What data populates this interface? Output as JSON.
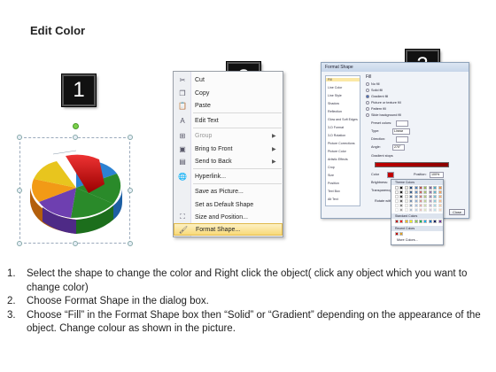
{
  "title": "Edit Color",
  "steps": {
    "badge1": "1",
    "badge2": "2",
    "badge3": "3"
  },
  "colors": {
    "pie_slices": [
      "#d11f1f",
      "#2a8a2a",
      "#6e3fb0",
      "#f29a16",
      "#e8c51e",
      "#2c82d2"
    ],
    "badge_bg": "#111111",
    "highlight": "#f8d978"
  },
  "context_menu": {
    "items": [
      {
        "label": "Cut",
        "icon": "scissors-icon",
        "disabled": false,
        "submenu": false
      },
      {
        "label": "Copy",
        "icon": "copy-icon",
        "disabled": false,
        "submenu": false
      },
      {
        "label": "Paste",
        "icon": "paste-icon",
        "disabled": false,
        "submenu": false
      },
      {
        "label": "Edit Text",
        "icon": "edit-text-icon",
        "disabled": false,
        "submenu": false
      },
      {
        "label": "Group",
        "icon": "group-icon",
        "disabled": true,
        "submenu": true
      },
      {
        "label": "Bring to Front",
        "icon": "bring-front-icon",
        "disabled": false,
        "submenu": true
      },
      {
        "label": "Send to Back",
        "icon": "send-back-icon",
        "disabled": false,
        "submenu": true
      },
      {
        "label": "Hyperlink...",
        "icon": "hyperlink-icon",
        "disabled": false,
        "submenu": false
      },
      {
        "label": "Save as Picture...",
        "icon": "",
        "disabled": false,
        "submenu": false
      },
      {
        "label": "Set as Default Shape",
        "icon": "",
        "disabled": false,
        "submenu": false
      },
      {
        "label": "Size and Position...",
        "icon": "size-icon",
        "disabled": false,
        "submenu": false
      },
      {
        "label": "Format Shape...",
        "icon": "format-shape-icon",
        "disabled": false,
        "submenu": false,
        "highlighted": true
      }
    ]
  },
  "format_dialog": {
    "title": "Format Shape",
    "nav": [
      "Fill",
      "Line Color",
      "Line Style",
      "Shadow",
      "Reflection",
      "Glow and Soft Edges",
      "3-D Format",
      "3-D Rotation",
      "Picture Corrections",
      "Picture Color",
      "Artistic Effects",
      "Crop",
      "Size",
      "Position",
      "Text Box",
      "Alt Text"
    ],
    "section_title": "Fill",
    "options": [
      "No fill",
      "Solid fill",
      "Gradient fill",
      "Picture or texture fill",
      "Pattern fill",
      "Slide background fill"
    ],
    "selected_option": "Gradient fill",
    "labels": {
      "preset": "Preset colors:",
      "type": "Type:",
      "type_value": "Linear",
      "direction": "Direction:",
      "angle": "Angle:",
      "angle_value": "270°",
      "stops": "Gradient stops",
      "color": "Color",
      "position": "Position:",
      "position_value": "100%",
      "brightness": "Brightness:",
      "transparency": "Transparency:",
      "rotate": "Rotate with shape",
      "close": "Close"
    },
    "palette": {
      "theme_label": "Theme Colors",
      "standard_label": "Standard Colors",
      "recent_label": "Recent Colors",
      "more_label": "More Colors...",
      "theme_row": [
        "#ffffff",
        "#000000",
        "#eeece1",
        "#1f497d",
        "#4f81bd",
        "#c0504d",
        "#9bbb59",
        "#8064a2",
        "#4bacc6",
        "#f79646"
      ],
      "standard_row": [
        "#c00000",
        "#ff0000",
        "#ffc000",
        "#ffff00",
        "#92d050",
        "#00b050",
        "#00b0f0",
        "#0070c0",
        "#002060",
        "#7030a0"
      ],
      "recent_row": [
        "#c00000",
        "#e0a020"
      ]
    }
  },
  "instructions": [
    {
      "num": "1.",
      "text": "Select the shape to change the color and Right click the object( click any object which you want to change color)"
    },
    {
      "num": "2.",
      "text": "Choose Format Shape in the dialog box."
    },
    {
      "num": "3.",
      "text": "Choose “Fill” in the Format Shape box then “Solid” or “Gradient” depending on the appearance of the object. Change colour as shown in the picture."
    }
  ]
}
